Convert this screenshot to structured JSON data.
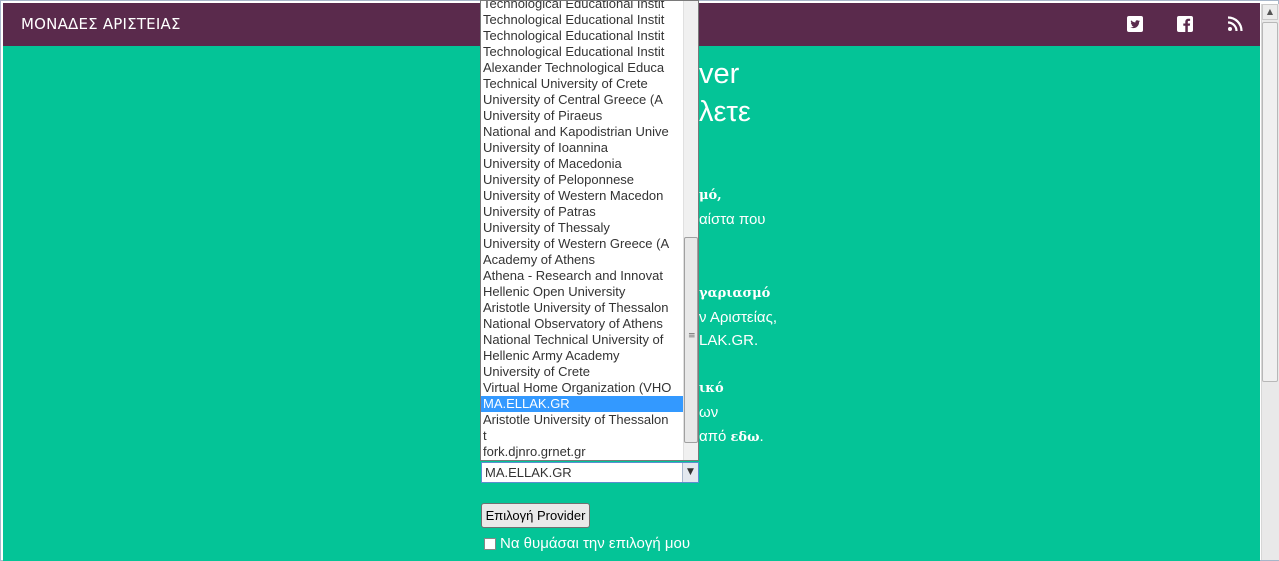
{
  "navbar": {
    "brand": "ΜΟΝΑΔΕΣ ΑΡΙΣΤΕΙΑΣ",
    "icons": [
      "twitter-icon",
      "facebook-icon",
      "rss-icon"
    ],
    "background": "#5a2a4c"
  },
  "content": {
    "background": "#04c497",
    "heading_line1_fragment": "ver",
    "heading_line2_fragment": "λετε",
    "p1_bold_fragment": "μό,",
    "p1_line2_fragment": "αίστα που",
    "p2_bold_fragment": "γαριασμό",
    "p2_line2_fragment": "ν Αριστείας,",
    "p2_line3_fragment": "LAK.GR.",
    "p3_bold_fragment": "ικό",
    "p3_line2_fragment": "ων",
    "p3_line3_prefix": "από ",
    "p3_line3_bold": "εδω",
    "p3_line3_suffix": "."
  },
  "provider_list": {
    "items": [
      "Technological Educational Instit",
      "Technological Educational Instit",
      "Technological Educational Instit",
      "Technological Educational Instit",
      "Alexander Technological Educa",
      "Technical University of Crete",
      "University of Central Greece (A",
      "University of Piraeus",
      "National and Kapodistrian Unive",
      "University of Ioannina",
      "University of Macedonia",
      "University of Peloponnese",
      "University of Western Macedon",
      "University of Patras",
      "University of Thessaly",
      "University of Western Greece (A",
      "Academy of Athens",
      "Athena - Research and Innovat",
      "Hellenic Open University",
      "Aristotle University of Thessalon",
      "National Observatory of Athens",
      "National Technical University of",
      "Hellenic Army Academy",
      "University of Crete",
      "Virtual Home Organization (VHO",
      "MA.ELLAK.GR",
      "Aristotle University of Thessalon",
      "t",
      "fork.djnro.grnet.gr"
    ],
    "selected_index": 25,
    "selected_color": "#3399ff"
  },
  "provider_select": {
    "value": "MA.ELLAK.GR"
  },
  "provider_button": {
    "label": "Επιλογή Provider"
  },
  "remember": {
    "label": "Να θυμάσαι την επιλογή μου",
    "checked": false
  }
}
